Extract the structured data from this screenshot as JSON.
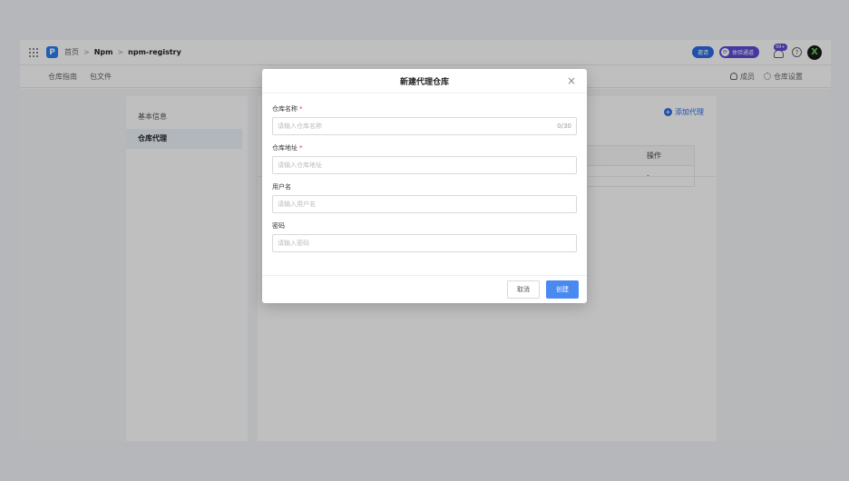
{
  "breadcrumb": {
    "home": "首页",
    "sep1": ">",
    "npm": "Npm",
    "sep2": ">",
    "repo": "npm-registry"
  },
  "topbar": {
    "pill1": "邀请",
    "pill2": "体验通道",
    "badge": "99+",
    "help": "?",
    "avatar": "X"
  },
  "subnav": {
    "tab1": "仓库指南",
    "tab2": "包文件",
    "members": "成员",
    "settings": "仓库设置"
  },
  "sidebar": {
    "items": [
      {
        "label": "基本信息"
      },
      {
        "label": "仓库代理"
      }
    ]
  },
  "main": {
    "add_proxy": "添加代理",
    "table_header": "操作",
    "table_cell": "-"
  },
  "modal": {
    "title": "新建代理仓库",
    "close": "×",
    "fields": [
      {
        "label": "仓库名称",
        "required": "*",
        "placeholder": "请输入仓库名称",
        "counter": "0/30"
      },
      {
        "label": "仓库地址",
        "required": "*",
        "placeholder": "请输入仓库地址"
      },
      {
        "label": "用户名",
        "placeholder": "请输入用户名"
      },
      {
        "label": "密码",
        "placeholder": "请输入密码"
      }
    ],
    "cancel": "取消",
    "create": "创建"
  }
}
